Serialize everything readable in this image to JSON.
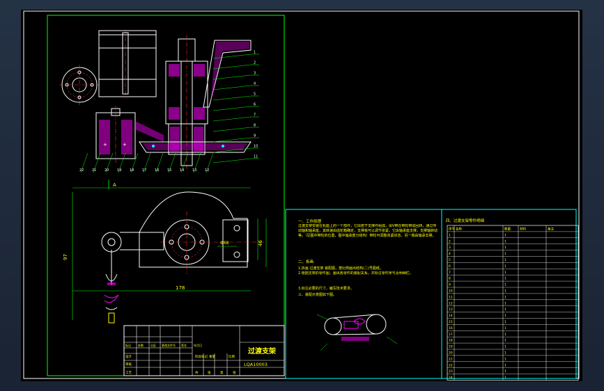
{
  "drawing": {
    "title_block": {
      "part_name": "过渡支架",
      "drawing_number": "LQA10003",
      "col_labels": [
        "标记",
        "处数",
        "分区",
        "更改文件号",
        "签名",
        "年月日"
      ],
      "row_labels": [
        "设计",
        "审核",
        "工艺"
      ],
      "bottom_labels": [
        "阶段标记",
        "重量",
        "比例"
      ],
      "bottom_row": [
        "共",
        "张",
        "第",
        "张"
      ]
    },
    "notes": {
      "heading1": "一、工作原理",
      "para1": "过渡支架安装在机座上的一个部件，它由若干支撑件组成，由V带在带轮带动回转，通过传动轴和轴承座，其转速由齿轮箱确定，支撑板可以调节张紧，它由轴承座支撑，支撑轴转动等。（见图中带轮的位置，图中轴承部分结构）带轮可调整张紧状态，另一端由轴承支撑。",
      "heading2": "二、拆画",
      "item1": "1.拆画 过渡支架 装配图，按比例画出结构(二)号图纸。",
      "item2": "2.根据支架的零件图，画出各零件的装配关系。并标注零件序号及明细栏。",
      "item3": "3.标注必要的尺寸，编写技术要求。",
      "heading3": "三、装配示意图如下图。"
    },
    "parts_table": {
      "title": "四、过渡支架零件明细",
      "headers": [
        "序号",
        "名称",
        "数量",
        "材料",
        "备注"
      ],
      "rows": [
        [
          "1",
          "",
          "1",
          "",
          ""
        ],
        [
          "2",
          "",
          "1",
          "",
          ""
        ],
        [
          "3",
          "",
          "1",
          "",
          ""
        ],
        [
          "4",
          "",
          "1",
          "",
          ""
        ],
        [
          "5",
          "",
          "1",
          "",
          ""
        ],
        [
          "6",
          "",
          "1",
          "",
          ""
        ],
        [
          "7",
          "",
          "1",
          "",
          ""
        ],
        [
          "8",
          "",
          "1",
          "",
          ""
        ],
        [
          "9",
          "",
          "1",
          "",
          ""
        ],
        [
          "10",
          "",
          "1",
          "",
          ""
        ],
        [
          "11",
          "",
          "1",
          "",
          ""
        ],
        [
          "12",
          "",
          "1",
          "",
          ""
        ],
        [
          "13",
          "",
          "1",
          "",
          ""
        ],
        [
          "14",
          "",
          "1",
          "",
          ""
        ],
        [
          "15",
          "",
          "1",
          "",
          ""
        ],
        [
          "16",
          "",
          "1",
          "",
          ""
        ],
        [
          "17",
          "",
          "1",
          "",
          ""
        ],
        [
          "18",
          "",
          "1",
          "",
          ""
        ],
        [
          "19",
          "",
          "1",
          "",
          ""
        ],
        [
          "20",
          "",
          "1",
          "",
          ""
        ],
        [
          "21",
          "",
          "1",
          "",
          ""
        ],
        [
          "22",
          "",
          "1",
          "",
          ""
        ],
        [
          "23",
          "",
          "1",
          "",
          ""
        ],
        [
          "24",
          "",
          "1",
          "",
          ""
        ]
      ]
    },
    "balloons_right": [
      "1",
      "2",
      "3",
      "4",
      "5",
      "6",
      "7",
      "8",
      "9",
      "10",
      "11"
    ],
    "balloons_bottom": [
      "22",
      "21",
      "20",
      "19",
      "18",
      "17",
      "16",
      "15",
      "14",
      "13",
      "12"
    ],
    "section_label": "A",
    "dims": {
      "overall_width": "178",
      "height_left": "97",
      "height_right": "46",
      "center_dist": "Φ68"
    },
    "colors": {
      "background": "#000000",
      "border": "#ffffff",
      "frame": "#00ff00",
      "panel": "#00ffff",
      "geometry": "#ffffff",
      "hatch": "#ff00ff",
      "center": "#ff3030",
      "text": "#ffff00",
      "dim": "#00ff00"
    }
  }
}
